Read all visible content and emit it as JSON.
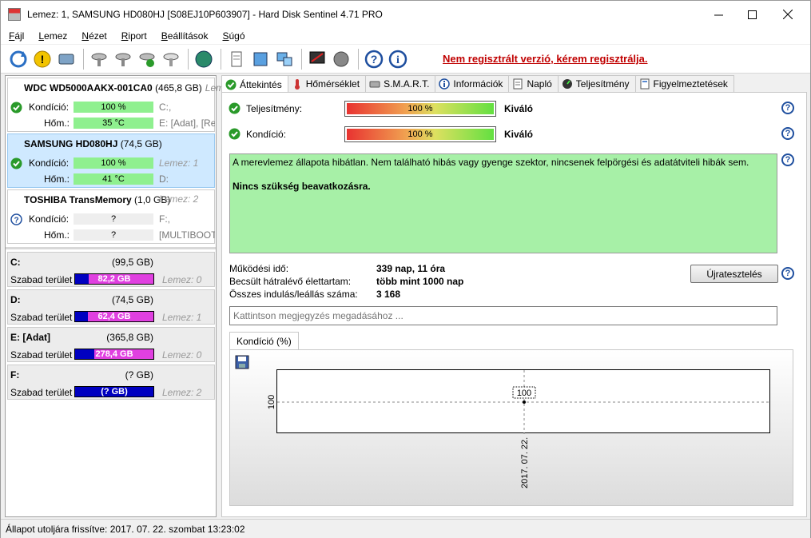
{
  "window": {
    "title": "Lemez: 1, SAMSUNG HD080HJ [S08EJ10P603907]  -  Hard Disk Sentinel 4.71 PRO"
  },
  "menu": [
    "Fájl",
    "Lemez",
    "Nézet",
    "Riport",
    "Beállítások",
    "Súgó"
  ],
  "toolbar": {
    "register_link": "Nem regisztrált verzió, kérem regisztrálja."
  },
  "disks": [
    {
      "name": "WDC WD5000AAKX-001CA0",
      "size": "(465,8 GB)",
      "lemez": "Lem",
      "condition_label": "Kondíció:",
      "condition_value": "100 %",
      "condition_drive": "C:,",
      "temp_label": "Hőm.:",
      "temp_value": "35 °C",
      "temp_drive": "E: [Adat],  [Re",
      "status": "ok",
      "condition_pct": 100
    },
    {
      "name": "SAMSUNG HD080HJ",
      "size": "(74,5 GB)",
      "lemez": "Lemez: 1",
      "condition_label": "Kondíció:",
      "condition_value": "100 %",
      "condition_drive": "D:",
      "temp_label": "Hőm.:",
      "temp_value": "41 °C",
      "temp_drive": "",
      "status": "ok",
      "condition_pct": 100
    },
    {
      "name": "TOSHIBA TransMemory",
      "size": "(1,0 GB)",
      "lemez": "Lemez: 2",
      "condition_label": "Kondíció:",
      "condition_value": "?",
      "condition_drive": "F:,",
      "temp_label": "Hőm.:",
      "temp_value": "?",
      "temp_drive": "[MULTIBOOT",
      "status": "unknown",
      "condition_pct": 0
    }
  ],
  "partitions": [
    {
      "letter": "C:",
      "size": "(99,5 GB)",
      "free_label": "Szabad terület",
      "free_value": "82,2 GB",
      "lemez": "Lemez: 0",
      "free_pct": 83
    },
    {
      "letter": "D:",
      "size": "(74,5 GB)",
      "free_label": "Szabad terület",
      "free_value": "62,4 GB",
      "lemez": "Lemez: 1",
      "free_pct": 84
    },
    {
      "letter": "E: [Adat]",
      "size": "(365,8 GB)",
      "free_label": "Szabad terület",
      "free_value": "278,4 GB",
      "lemez": "Lemez: 0",
      "free_pct": 76
    },
    {
      "letter": "F:",
      "size": "(? GB)",
      "free_label": "Szabad terület",
      "free_value": "(? GB)",
      "lemez": "Lemez: 2",
      "free_pct": 0
    }
  ],
  "tabs": [
    "Áttekintés",
    "Hőmérséklet",
    "S.M.A.R.T.",
    "Információk",
    "Napló",
    "Teljesítmény",
    "Figyelmeztetések"
  ],
  "overview": {
    "performance_label": "Teljesítmény:",
    "performance_value": "100 %",
    "performance_word": "Kiváló",
    "condition_label": "Kondíció:",
    "condition_value": "100 %",
    "condition_word": "Kiváló",
    "message_1": "A merevlemez állapota hibátlan. Nem található hibás vagy gyenge szektor, nincsenek felpörgési és adatátviteli hibák sem.",
    "message_2": "Nincs szükség beavatkozásra.",
    "uptime_label": "Működési idő:",
    "uptime_value": "339 nap, 11 óra",
    "lifetime_label": "Becsült hátralévő élettartam:",
    "lifetime_value": "több mint 1000 nap",
    "startstop_label": "Összes indulás/leállás száma:",
    "startstop_value": "3 168",
    "reset_button": "Újratesztelés",
    "note_placeholder": "Kattintson megjegyzés megadásához ...",
    "chart_tab": "Kondíció  (%)"
  },
  "chart_data": {
    "type": "line",
    "x": [
      "2017. 07. 22."
    ],
    "series": [
      {
        "values": [
          100
        ]
      }
    ],
    "ylim": [
      100,
      100
    ],
    "data_labels": [
      "100"
    ],
    "ytick": "100"
  },
  "statusbar": {
    "text": "Állapot utoljára frissítve: 2017. 07. 22. szombat 13:23:02"
  },
  "colors": {
    "ok_green": "#2a9a2a",
    "warning_red": "#c00000",
    "good_bar": "#8ff08f",
    "free_blue": "#0000c0",
    "free_magenta": "#e040e0"
  }
}
